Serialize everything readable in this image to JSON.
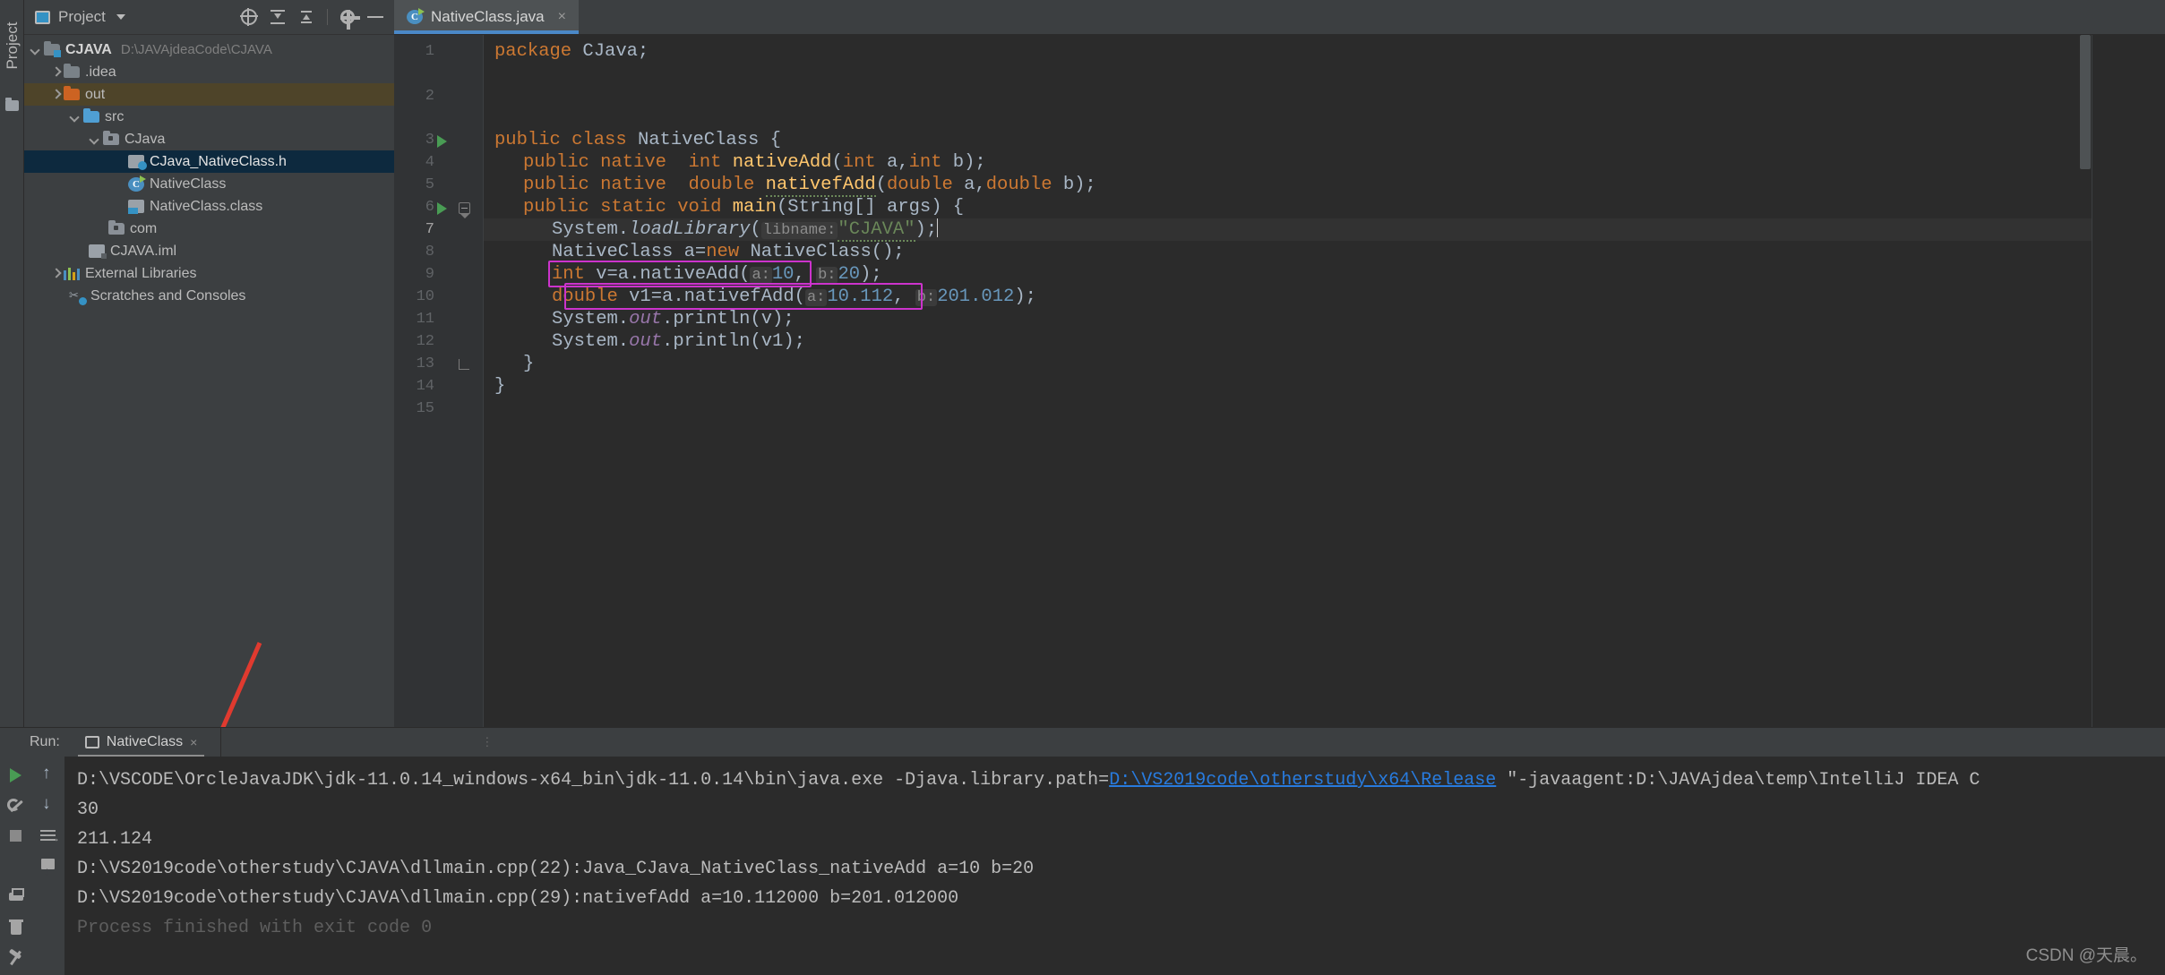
{
  "window": {
    "left_strip": {
      "project_tab": "Project",
      "structure_icon": "folder-icon"
    }
  },
  "project_panel": {
    "header": {
      "title": "Project",
      "icons": [
        "locate-icon",
        "expand-all-icon",
        "collapse-all-icon",
        "gear-icon",
        "minimize-icon"
      ]
    },
    "tree": [
      {
        "label": "CJAVA",
        "sub": "D:\\JAVAjdeaCode\\CJAVA",
        "icon": "project-root-folder-icon",
        "arrow": "down",
        "indent": 0,
        "state": "normal",
        "bold": true
      },
      {
        "label": ".idea",
        "sub": "",
        "icon": "folder-icon",
        "arrow": "right",
        "indent": 1,
        "state": "normal",
        "bold": false
      },
      {
        "label": "out",
        "sub": "",
        "icon": "folder-orange-icon",
        "arrow": "right",
        "indent": 1,
        "state": "highlight",
        "bold": false
      },
      {
        "label": "src",
        "sub": "",
        "icon": "folder-blue-icon",
        "arrow": "down",
        "indent": 1,
        "state": "normal",
        "bold": false
      },
      {
        "label": "CJava",
        "sub": "",
        "icon": "package-folder-icon",
        "arrow": "down",
        "indent": 2,
        "state": "normal",
        "bold": false
      },
      {
        "label": "CJava_NativeClass.h",
        "sub": "",
        "icon": "header-file-icon",
        "arrow": "none",
        "indent": 3,
        "state": "selected",
        "bold": false
      },
      {
        "label": "NativeClass",
        "sub": "",
        "icon": "java-class-icon",
        "arrow": "none",
        "indent": 3,
        "state": "normal",
        "bold": false
      },
      {
        "label": "NativeClass.class",
        "sub": "",
        "icon": "class-file-icon",
        "arrow": "none",
        "indent": 3,
        "state": "normal",
        "bold": false
      },
      {
        "label": "com",
        "sub": "",
        "icon": "package-folder-icon",
        "arrow": "none",
        "indent": 2,
        "state": "normal",
        "bold": false
      },
      {
        "label": "CJAVA.iml",
        "sub": "",
        "icon": "iml-file-icon",
        "arrow": "none",
        "indent": 1,
        "state": "normal",
        "bold": false
      },
      {
        "label": "External Libraries",
        "sub": "",
        "icon": "libraries-icon",
        "arrow": "right",
        "indent": 0,
        "state": "normal",
        "bold": false
      },
      {
        "label": "Scratches and Consoles",
        "sub": "",
        "icon": "scratches-icon",
        "arrow": "none",
        "indent": 0,
        "state": "normal",
        "bold": false
      }
    ]
  },
  "editor": {
    "tab": {
      "label": "NativeClass.java",
      "icon": "java-class-icon",
      "close": "×"
    },
    "line_numbers": [
      "1",
      "2",
      "3",
      "4",
      "5",
      "6",
      "7",
      "8",
      "9",
      "10",
      "11",
      "12",
      "13",
      "14",
      "15"
    ],
    "current_line": "7",
    "gutter_run_marks": [
      "3",
      "6"
    ],
    "code": {
      "l1_kw": "package",
      "l1_rest": " CJava;",
      "l3_a": "public class ",
      "l3_b": "NativeClass",
      "l3_c": " {",
      "l4_a": "public native ",
      "l4_b": " int ",
      "l4_c": "nativeAdd",
      "l4_d": "(",
      "l4_e": "int",
      "l4_f": " a,",
      "l4_g": "int",
      "l4_h": " b);",
      "l5_a": "public native ",
      "l5_b": " double ",
      "l5_c": "nativefAdd",
      "l5_d": "(",
      "l5_e": "double",
      "l5_f": " a,",
      "l5_g": "double",
      "l5_h": " b);",
      "l6_a": "public static void ",
      "l6_b": "main",
      "l6_c": "(String[] args) {",
      "l7_a": "System.",
      "l7_b": "loadLibrary",
      "l7_c": "(",
      "l7_hint": "libname:",
      "l7_str": "\"CJAVA\"",
      "l7_end": ");",
      "l8_a": "NativeClass a=",
      "l8_kw": "new",
      "l8_b": " NativeClass();",
      "l9_kw": "int",
      "l9_a": " v=a.nativeAdd(",
      "l9_hint_a": "a:",
      "l9_num_a": "10",
      "l9_comma": ", ",
      "l9_hint_b": "b:",
      "l9_num_b": "20",
      "l9_end": ");",
      "l10_kw": "double",
      "l10_a": " v1=a.nativefAdd(",
      "l10_hint_a": "a:",
      "l10_num_a": "10.112",
      "l10_comma": ", ",
      "l10_hint_b": "b:",
      "l10_num_b": "201.012",
      "l10_end": ");",
      "l11_a": "System.",
      "l11_b": "out",
      "l11_c": ".println(v);",
      "l12_a": "System.",
      "l12_b": "out",
      "l12_c": ".println(v1);",
      "l13": "}",
      "l14": "}"
    },
    "colors": {
      "keyword": "#cc7832",
      "method": "#ffc66d",
      "number": "#6897bb",
      "string": "#6a8759",
      "static_field": "#9876aa",
      "highlight_box": "#cc33cc",
      "background": "#2b2b2b",
      "annotation_arrow": "#e03a2f"
    }
  },
  "run_panel": {
    "label": "Run:",
    "tab": {
      "label": "NativeClass",
      "icon": "run-config-icon",
      "close": "×"
    },
    "toolbar_icons": [
      "rerun-play-icon",
      "up-arrow-icon",
      "wrench-icon",
      "down-arrow-icon",
      "stop-icon",
      "soft-wrap-icon",
      "scroll-to-end-icon",
      "print-icon",
      "trash-icon",
      "pin-icon"
    ],
    "console_lines": [
      {
        "segments": [
          {
            "text": "D:\\VSCODE\\OrcleJavaJDK\\jdk-11.0.14_windows-x64_bin\\jdk-11.0.14\\bin\\java.exe -Djava.library.path=",
            "link": false
          },
          {
            "text": "D:\\VS2019code\\otherstudy\\x64\\Release",
            "link": true
          },
          {
            "text": " \"-javaagent:D:\\JAVAjdea\\temp\\IntelliJ IDEA C",
            "link": false
          }
        ]
      },
      {
        "segments": [
          {
            "text": "30",
            "link": false
          }
        ]
      },
      {
        "segments": [
          {
            "text": "211.124",
            "link": false
          }
        ]
      },
      {
        "segments": [
          {
            "text": "D:\\VS2019code\\otherstudy\\CJAVA\\dllmain.cpp(22):Java_CJava_NativeClass_nativeAdd a=10 b=20",
            "link": false
          }
        ]
      },
      {
        "segments": [
          {
            "text": "D:\\VS2019code\\otherstudy\\CJAVA\\dllmain.cpp(29):nativefAdd a=10.112000 b=201.012000",
            "link": false
          }
        ]
      },
      {
        "segments": [
          {
            "text": "",
            "link": false
          }
        ]
      },
      {
        "segments": [
          {
            "text": "Process finished with exit code 0",
            "link": false
          }
        ]
      }
    ]
  },
  "watermark": {
    "text": "CSDN @天晨。"
  }
}
